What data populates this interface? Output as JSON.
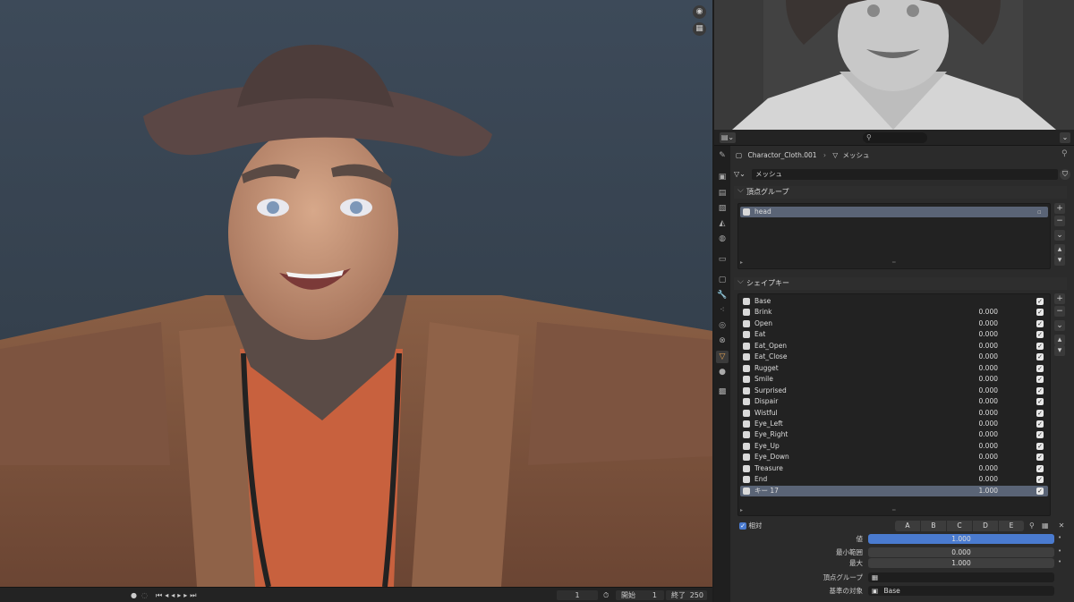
{
  "timeline": {
    "current_frame": "1",
    "start_label": "開始",
    "start_value": "1",
    "end_label": "終了",
    "end_value": "250"
  },
  "viewport_icons": [
    "camera-icon",
    "grid-icon"
  ],
  "header": {
    "object_name": "Charactor_Cloth.001",
    "data_type": "メッシュ",
    "data_name": "メッシュ"
  },
  "vertex_groups": {
    "title": "頂点グループ",
    "items": [
      {
        "name": "head"
      }
    ]
  },
  "shape_keys": {
    "title": "シェイプキー",
    "items": [
      {
        "name": "Base",
        "value": ""
      },
      {
        "name": "Brink",
        "value": "0.000"
      },
      {
        "name": "Open",
        "value": "0.000"
      },
      {
        "name": "Eat",
        "value": "0.000"
      },
      {
        "name": "Eat_Open",
        "value": "0.000"
      },
      {
        "name": "Eat_Close",
        "value": "0.000"
      },
      {
        "name": "Rugget",
        "value": "0.000"
      },
      {
        "name": "Smile",
        "value": "0.000"
      },
      {
        "name": "Surprised",
        "value": "0.000"
      },
      {
        "name": "Dispair",
        "value": "0.000"
      },
      {
        "name": "Wistful",
        "value": "0.000"
      },
      {
        "name": "Eye_Left",
        "value": "0.000"
      },
      {
        "name": "Eye_Right",
        "value": "0.000"
      },
      {
        "name": "Eye_Up",
        "value": "0.000"
      },
      {
        "name": "Eye_Down",
        "value": "0.000"
      },
      {
        "name": "Treasure",
        "value": "0.000"
      },
      {
        "name": "End",
        "value": "0.000"
      },
      {
        "name": "キー 17",
        "value": "1.000"
      }
    ],
    "relative_label": "相対",
    "letters": [
      "A",
      "B",
      "C",
      "D",
      "E"
    ],
    "value_label": "値",
    "value": "1.000",
    "value_fraction": 1.0,
    "min_label": "最小範囲",
    "min_value": "0.000",
    "max_label": "最大",
    "max_value": "1.000",
    "vgroup_label": "頂点グループ",
    "relative_to_label": "基準の対象",
    "relative_to_value": "Base"
  },
  "colors": {
    "accent": "#4a7bd0",
    "selection": "#5a6476",
    "active_tab": "#e6a455"
  }
}
